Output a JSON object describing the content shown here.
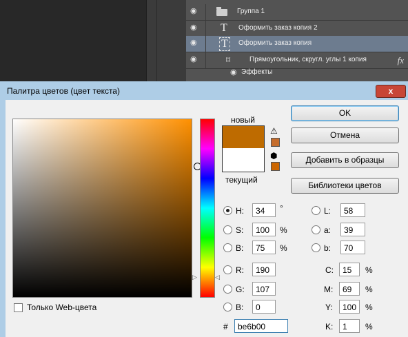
{
  "layers": [
    {
      "name": "Группа 1",
      "kind": "group",
      "selected": false,
      "icon": "folder-icon"
    },
    {
      "name": "Оформить заказ копия 2",
      "kind": "text",
      "selected": false,
      "icon": "text-layer-icon"
    },
    {
      "name": "Оформить заказ копия",
      "kind": "text",
      "selected": true,
      "icon": "text-layer-icon"
    },
    {
      "name": "Прямоугольник, скругл. углы 1 копия",
      "kind": "shape",
      "selected": false,
      "icon": "shape-layer-icon",
      "fx": "fx"
    },
    {
      "name": "Эффекты",
      "kind": "effects",
      "selected": false,
      "icon": "eye-icon"
    }
  ],
  "dialog": {
    "title": "Палитра цветов (цвет текста)",
    "close": "x",
    "new_label": "новый",
    "current_label": "текущий",
    "new_color": "#be6b00",
    "current_color": "#ffffff",
    "warning_swatch": "#c46c2c",
    "web_swatch": "#cc6600",
    "web_only_label": "Только Web-цвета",
    "buttons": {
      "ok": "OK",
      "cancel": "Отмена",
      "add": "Добавить в образцы",
      "libs": "Библиотеки цветов"
    },
    "hsb": {
      "h_label": "H:",
      "h": "34",
      "h_unit": "°",
      "s_label": "S:",
      "s": "100",
      "s_unit": "%",
      "b_label": "B:",
      "b": "75",
      "b_unit": "%"
    },
    "lab": {
      "l_label": "L:",
      "l": "58",
      "a_label": "a:",
      "a": "39",
      "b_label": "b:",
      "b": "70"
    },
    "rgb": {
      "r_label": "R:",
      "r": "190",
      "g_label": "G:",
      "g": "107",
      "b_label": "B:",
      "b": "0"
    },
    "cmyk": {
      "c_label": "C:",
      "c": "15",
      "m_label": "M:",
      "m": "69",
      "y_label": "Y:",
      "y": "100",
      "k_label": "K:",
      "k": "1",
      "unit": "%"
    },
    "hex_label": "#",
    "hex": "be6b00",
    "selected_mode": "H"
  }
}
